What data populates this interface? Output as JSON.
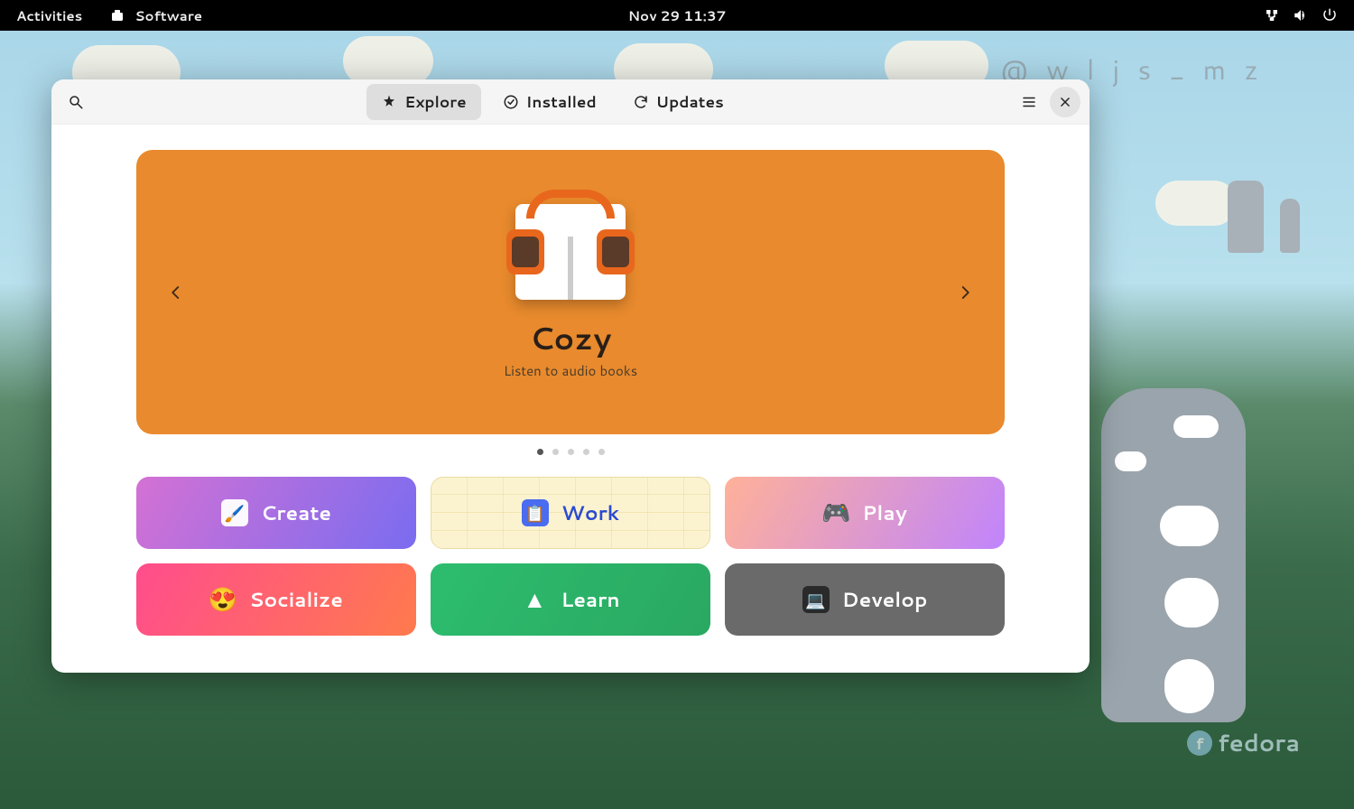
{
  "topbar": {
    "activities": "Activities",
    "app_name": "Software",
    "datetime": "Nov 29  11:37"
  },
  "watermark": "@ w l j s _ m z",
  "fedora": "fedora",
  "window": {
    "tabs": {
      "explore": "Explore",
      "installed": "Installed",
      "updates": "Updates"
    },
    "hero": {
      "title": "Cozy",
      "subtitle": "Listen to audio books",
      "slide_count": 5,
      "active_slide": 0
    },
    "categories": [
      {
        "key": "create",
        "label": "Create",
        "icon": "🖌️"
      },
      {
        "key": "work",
        "label": "Work",
        "icon": "📋"
      },
      {
        "key": "play",
        "label": "Play",
        "icon": "🎮"
      },
      {
        "key": "social",
        "label": "Socialize",
        "icon": "😍"
      },
      {
        "key": "learn",
        "label": "Learn",
        "icon": "▲"
      },
      {
        "key": "develop",
        "label": "Develop",
        "icon": "💻"
      }
    ]
  }
}
